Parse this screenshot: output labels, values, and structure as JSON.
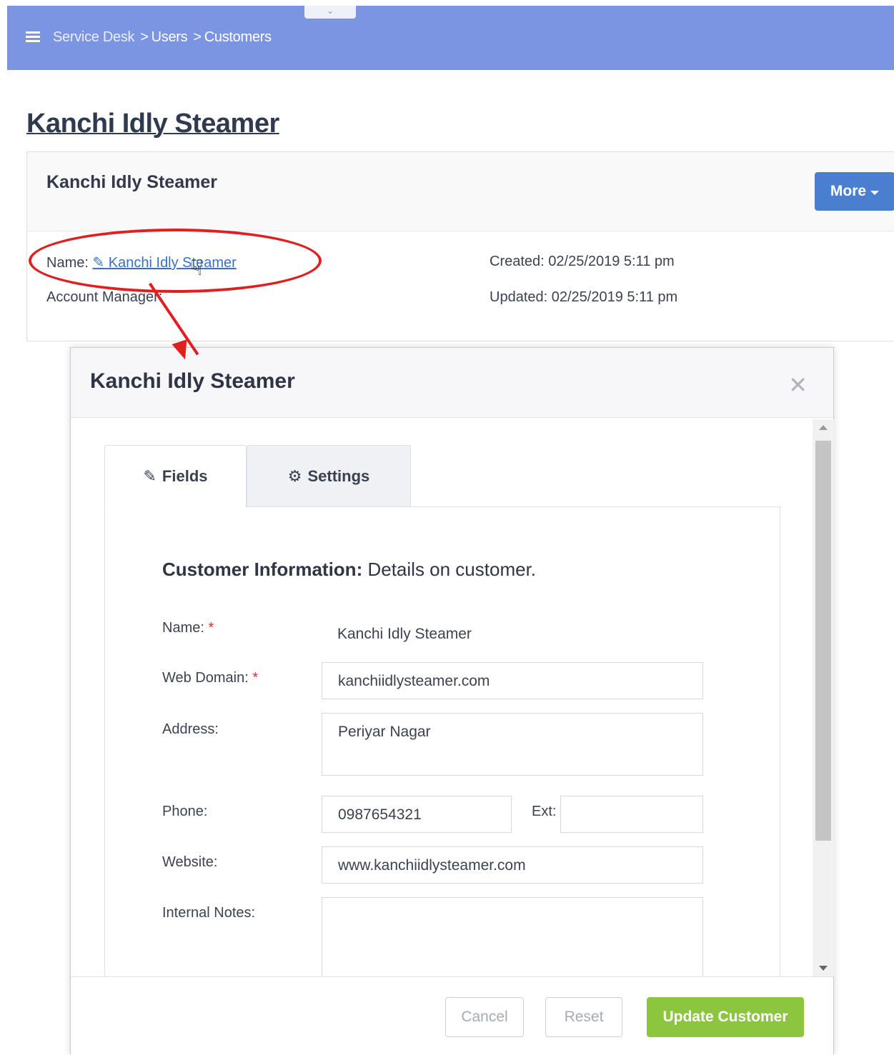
{
  "topbar": {
    "collapse_icon": "chevron-down-icon",
    "breadcrumb": [
      "Service Desk",
      "Users",
      "Customers"
    ]
  },
  "page": {
    "title": "Kanchi Idly Steamer"
  },
  "card": {
    "title": "Kanchi Idly Steamer",
    "more_label": "More",
    "name_label": "Name:",
    "name_value": "Kanchi Idly Steamer",
    "account_manager_label": "Account Manager:",
    "created": "Created: 02/25/2019 5:11 pm",
    "updated": "Updated: 02/25/2019 5:11 pm"
  },
  "modal": {
    "title": "Kanchi Idly Steamer",
    "close_icon": "close-icon",
    "tabs": [
      {
        "label": "Fields",
        "icon": "edit-icon",
        "active": true
      },
      {
        "label": "Settings",
        "icon": "gears-icon",
        "active": false
      }
    ],
    "section_title_bold": "Customer Information:",
    "section_title_rest": "Details on customer.",
    "fields": {
      "name_label": "Name:",
      "name_value": "Kanchi Idly Steamer",
      "web_domain_label": "Web Domain:",
      "web_domain_value": "kanchiidlysteamer.com",
      "address_label": "Address:",
      "address_value": "Periyar Nagar",
      "phone_label": "Phone:",
      "phone_value": "0987654321",
      "ext_label": "Ext:",
      "ext_value": "",
      "website_label": "Website:",
      "website_value": "www.kanchiidlysteamer.com",
      "notes_label": "Internal Notes:",
      "notes_value": ""
    },
    "required_mark": "*",
    "buttons": {
      "cancel": "Cancel",
      "reset": "Reset",
      "update": "Update Customer"
    }
  },
  "colors": {
    "topbar": "#7b95e3",
    "primary_button": "#4a7fd0",
    "update_button": "#8cc63f",
    "annotation": "#e02020"
  }
}
